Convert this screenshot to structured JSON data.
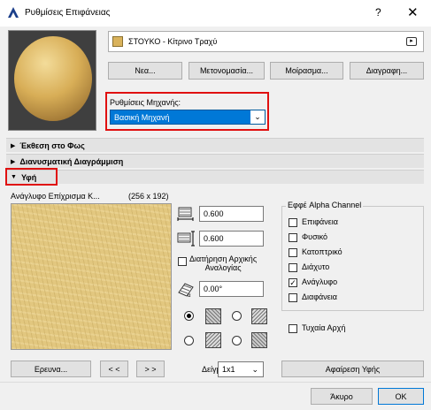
{
  "window": {
    "title": "Ρυθμίσεις Επιφάνειας",
    "help": "?",
    "close": "✕"
  },
  "surface": {
    "name": "ΣΤΟΥΚΟ - Κίτρινο Τραχύ"
  },
  "buttons": {
    "new": "Νεα...",
    "rename": "Μετονομασία...",
    "share": "Μοίρασμα...",
    "delete": "Διαγραφη..."
  },
  "engine": {
    "label": "Ρυθμίσεις Μηχανής:",
    "value": "Βασική Μηχανή"
  },
  "sections": {
    "light": "Έκθεση στο Φως",
    "vector": "Διανυσματική Διαγράμμιση",
    "texture": "Υφή"
  },
  "texture": {
    "name": "Ανάγλυφο Επίχρισμα Κ...",
    "size": "(256 x 192)",
    "width": "0.600",
    "height": "0.600",
    "keep_ratio_line1": "Διατήρηση Αρχικής",
    "keep_ratio_line2": "Αναλογίας",
    "angle": "0.00°",
    "browse": "Ερευνα...",
    "prev": "< <",
    "next": "> >",
    "sample_label": "Δείγμα:",
    "sample_value": "1x1",
    "remove": "Αφαίρεση Υφής"
  },
  "alpha": {
    "title": "Εφφέ Alpha Channel",
    "items": [
      {
        "label": "Επιφάνεια",
        "checked": false
      },
      {
        "label": "Φυσικό",
        "checked": false
      },
      {
        "label": "Κατοπτρικό",
        "checked": false
      },
      {
        "label": "Διάχυτο",
        "checked": false
      },
      {
        "label": "Ανάγλυφο",
        "checked": true
      },
      {
        "label": "Διαφάνεια",
        "checked": false
      }
    ],
    "random_origin": "Τυχαία Αρχή"
  },
  "footer": {
    "cancel": "Άκυρο",
    "ok": "OK"
  },
  "colors": {
    "accent": "#0078d7",
    "highlight_border": "#e01010",
    "swatch": "#d9b25b",
    "sample_texture": "#e2c77f"
  }
}
